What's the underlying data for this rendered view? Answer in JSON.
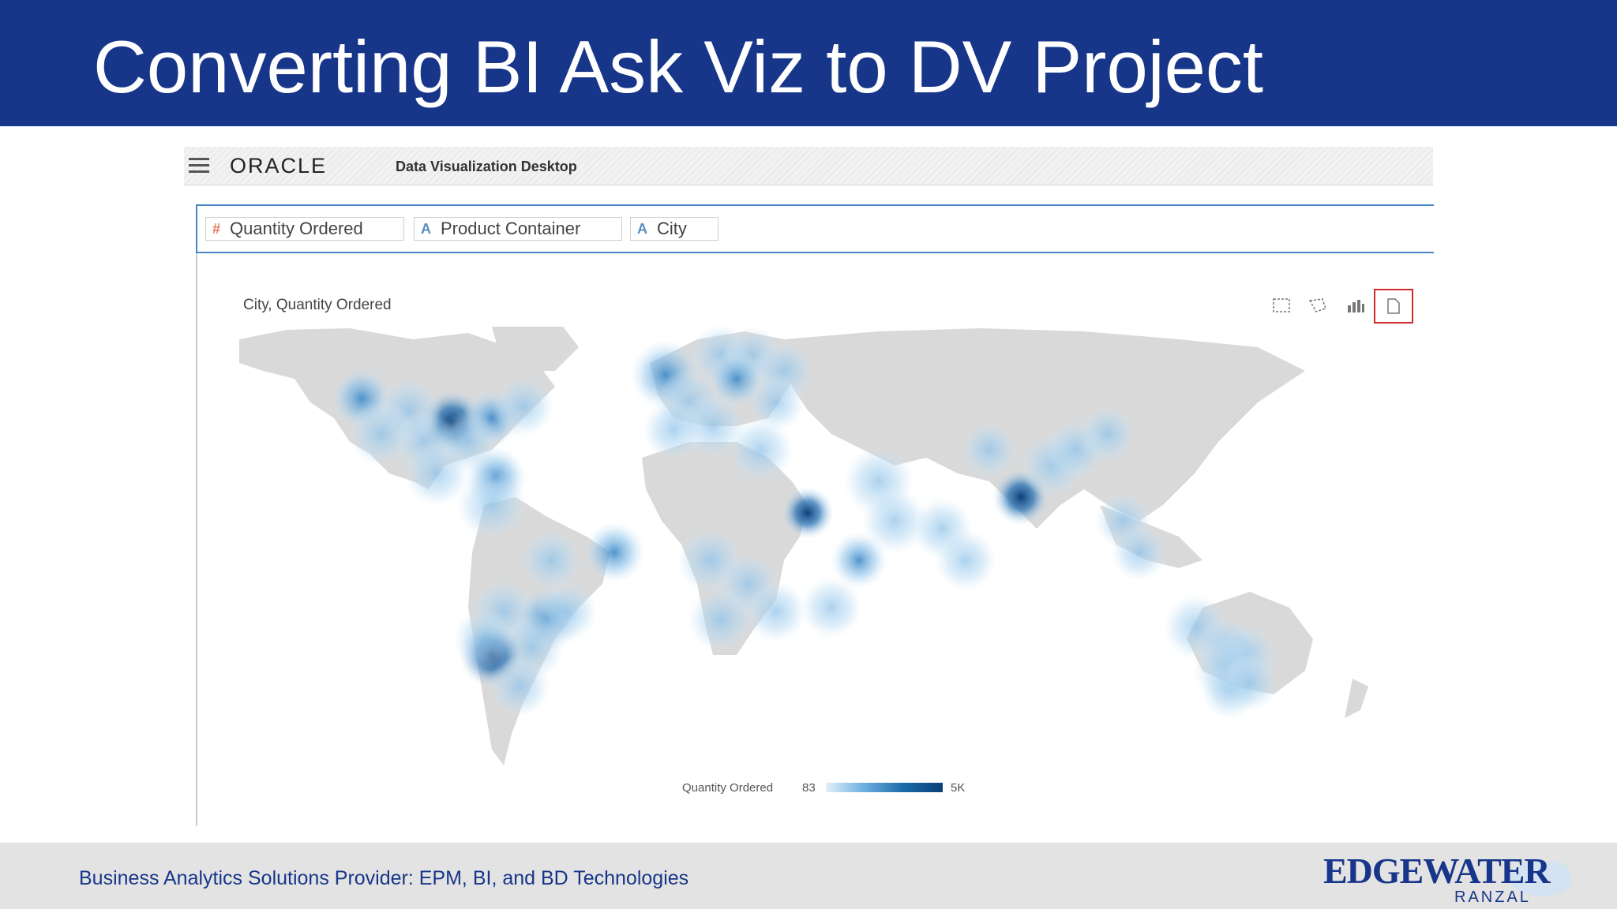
{
  "slide": {
    "title": "Converting BI Ask Viz to DV Project",
    "footer": "Business Analytics Solutions Provider:  EPM, BI, and BD Technologies",
    "brand_main": "EDGEWATER",
    "brand_sub": "RANZAL"
  },
  "app": {
    "logo": "ORACLE",
    "name": "Data Visualization Desktop",
    "menu_icon": "hamburger-menu-icon"
  },
  "query": {
    "pills": [
      {
        "label": "Quantity Ordered",
        "type": "measure",
        "icon": "#"
      },
      {
        "label": "Product Container",
        "type": "attribute",
        "icon": "A"
      },
      {
        "label": "City",
        "type": "attribute",
        "icon": "A"
      }
    ]
  },
  "viz": {
    "title": "City, Quantity Ordered",
    "toolbar": [
      "marquee-select-icon",
      "lasso-select-icon",
      "bar-chart-icon",
      "new-canvas-icon"
    ],
    "legend": {
      "label": "Quantity Ordered",
      "min": "83",
      "max": "5K"
    },
    "colors": {
      "accent": "#17368a",
      "highlight": "#d22b2b",
      "heat": "#0b3f78"
    }
  }
}
